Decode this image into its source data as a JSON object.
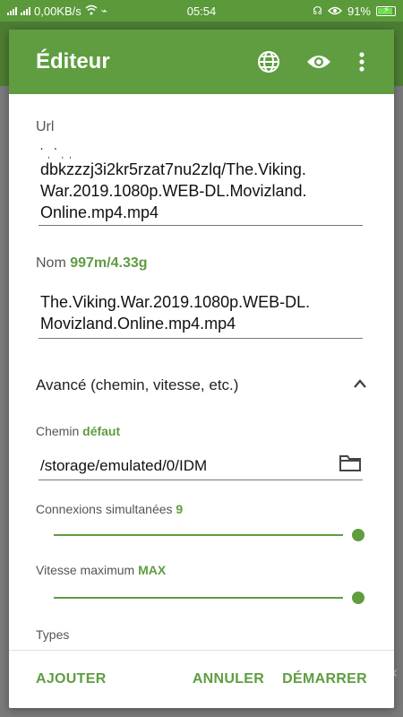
{
  "status_bar": {
    "speed": "0,00KB/s",
    "time": "05:54",
    "battery": "91%",
    "battery_level": 0.91
  },
  "dialog": {
    "title": "Éditeur",
    "icons": [
      "globe-icon",
      "eye-icon",
      "more-vert-icon"
    ],
    "url": {
      "label": "Url",
      "partial_line": "ʻ ˌ ʻ ˌ ˌ",
      "value": "dbkzzzj3i2kr5rzat7nu2zlq/The.Viking.\nWar.2019.1080p.WEB-DL.Movizland.\nOnline.mp4.mp4"
    },
    "name": {
      "label": "Nom",
      "size": "997m/4.33g",
      "value": "The.Viking.War.2019.1080p.WEB-DL.\nMovizland.Online.mp4.mp4"
    },
    "advanced": {
      "title": "Avancé (chemin, vitesse, etc.)",
      "expanded": true
    },
    "path": {
      "label": "Chemin",
      "badge": "défaut",
      "value": "/storage/emulated/0/IDM"
    },
    "connections": {
      "label": "Connexions simultanées",
      "value": "9",
      "level": 1.0
    },
    "speed": {
      "label": "Vitesse maximum",
      "value": "MAX",
      "level": 1.0
    },
    "types": {
      "label": "Types"
    },
    "buttons": {
      "add": "AJOUTER",
      "cancel": "ANNULER",
      "start": "DÉMARRER"
    }
  },
  "colors": {
    "accent": "#5f9d40",
    "status_bar": "#5a9a3a"
  }
}
